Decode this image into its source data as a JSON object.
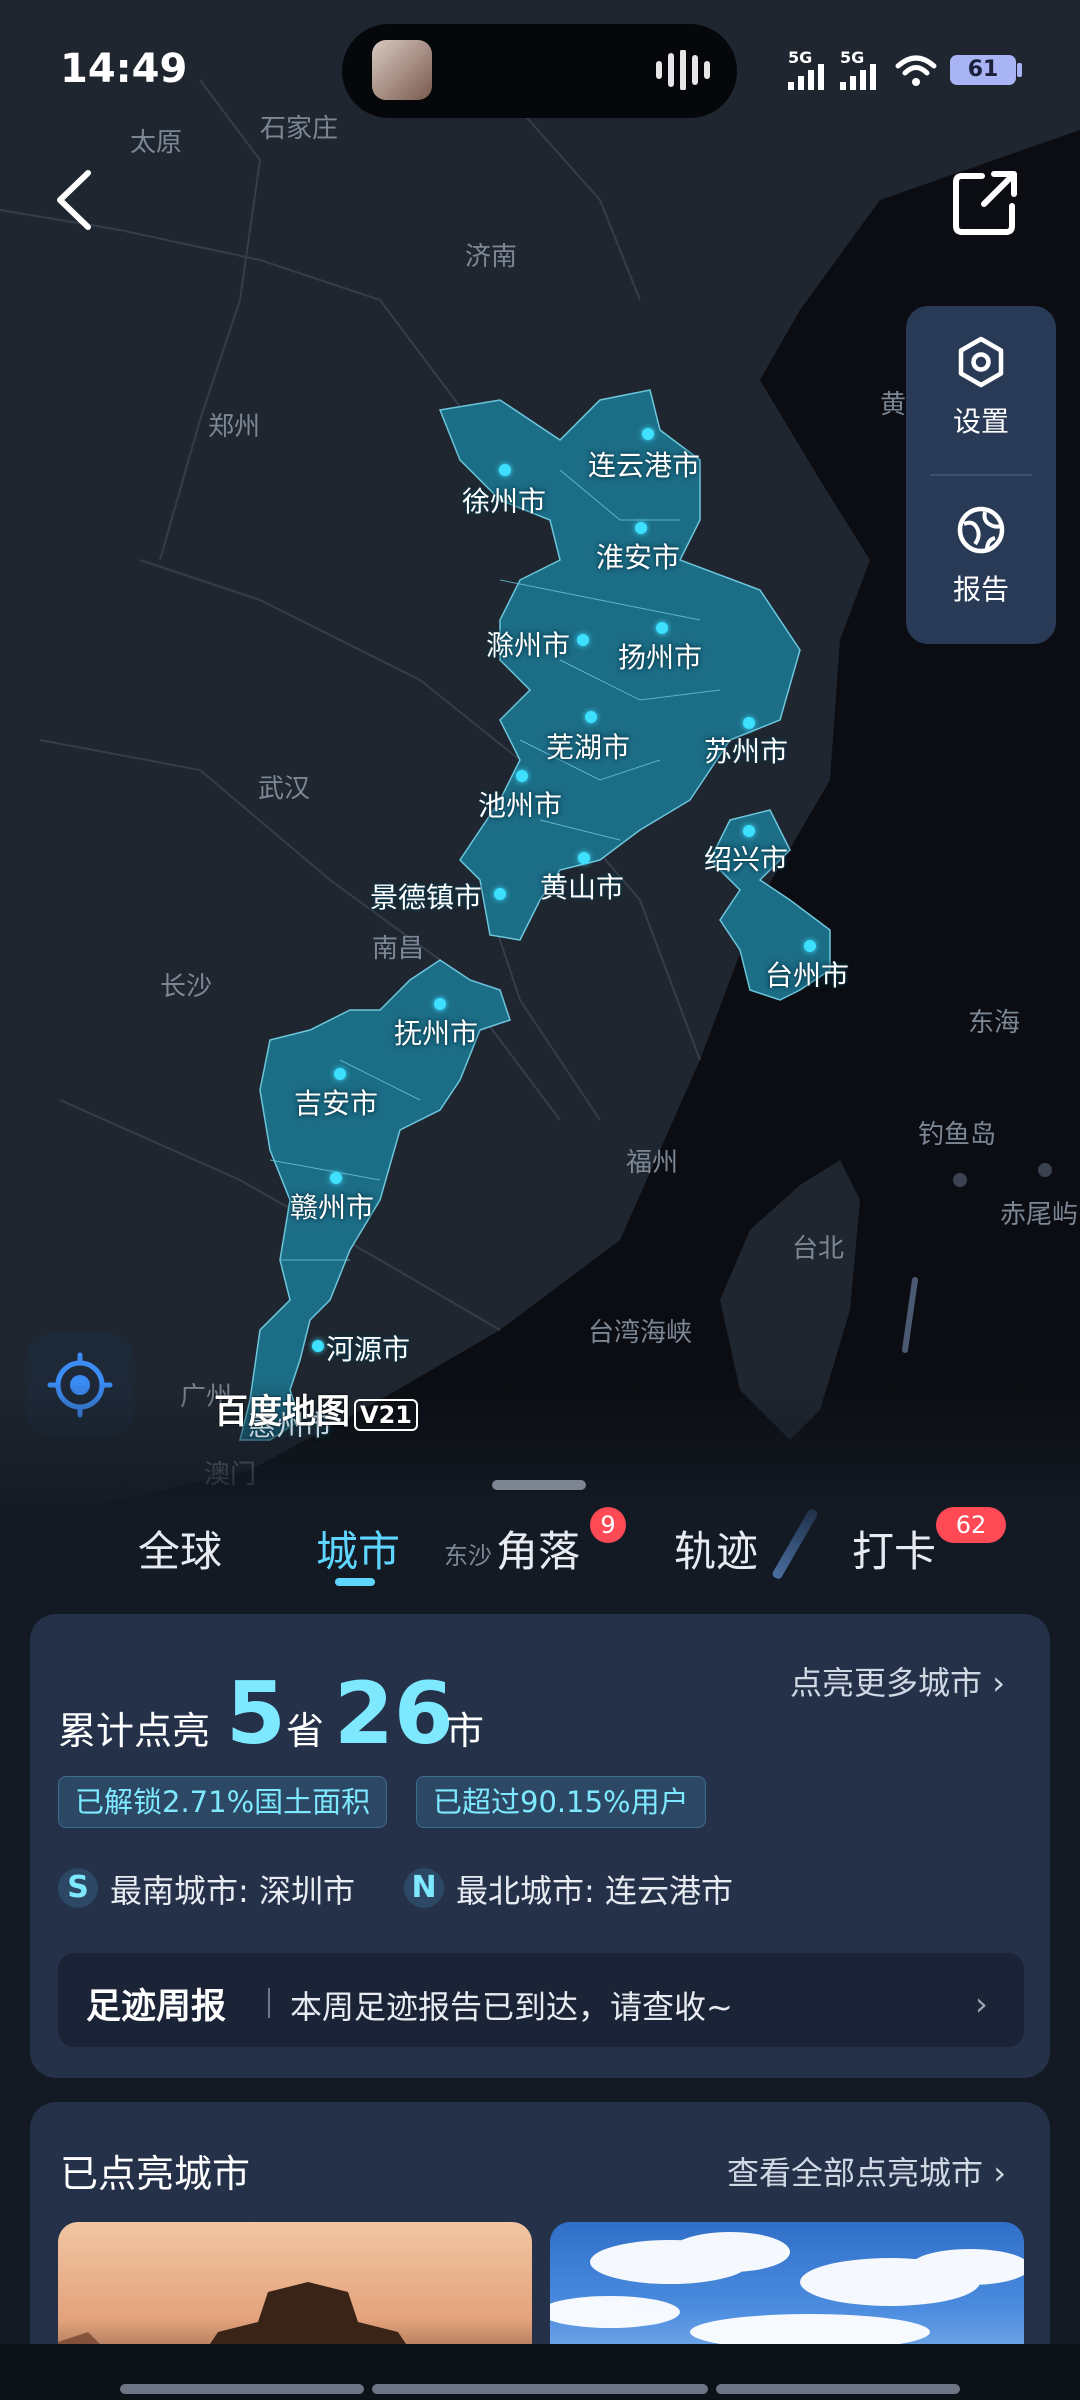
{
  "status_bar": {
    "time": "14:49",
    "signal_1": "5G",
    "signal_2": "5G",
    "battery": "61"
  },
  "map": {
    "places": [
      "太原",
      "石家庄",
      "济南",
      "郑州",
      "武汉",
      "南昌",
      "长沙",
      "福州",
      "台湾海峡",
      "台北",
      "东海",
      "钓鱼岛",
      "赤尾屿",
      "广州",
      "澳门",
      "东沙",
      "黄"
    ],
    "lit_cities": [
      "连云港市",
      "徐州市",
      "淮安市",
      "滁州市",
      "扬州市",
      "芜湖市",
      "苏州市",
      "池州市",
      "黄山市",
      "景德镇市",
      "绍兴市",
      "台州市",
      "抚州市",
      "吉安市",
      "赣州市",
      "河源市",
      "惠州市"
    ],
    "logo_text": "百度地图",
    "logo_version": "V21",
    "region_color": "#1c6d86"
  },
  "side_panel": {
    "settings_label": "设置",
    "report_label": "报告"
  },
  "tabs": [
    {
      "label": "全球",
      "active": false
    },
    {
      "label": "城市",
      "active": true
    },
    {
      "label": "角落",
      "active": false,
      "badge": "9"
    },
    {
      "label": "轨迹",
      "active": false
    },
    {
      "label": "打卡",
      "active": false,
      "badge": "62"
    }
  ],
  "stats": {
    "prefix": "累计点亮",
    "provinces": "5",
    "province_unit": "省",
    "cities": "26",
    "city_unit": "市",
    "more_link": "点亮更多城市",
    "unlocked_area": "已解锁2.71%国土面积",
    "beat_users": "已超过90.15%用户",
    "south_badge": "S",
    "south_text": "最南城市: 深圳市",
    "north_badge": "N",
    "north_text": "最北城市: 连云港市",
    "weekly_title": "足迹周报",
    "weekly_text": "本周足迹报告已到达，请查收~"
  },
  "lit_section": {
    "title": "已点亮城市",
    "view_all": "查看全部点亮城市"
  },
  "colors": {
    "accent": "#5fd6ff",
    "badge": "#ff4a55",
    "card": "#243149"
  }
}
